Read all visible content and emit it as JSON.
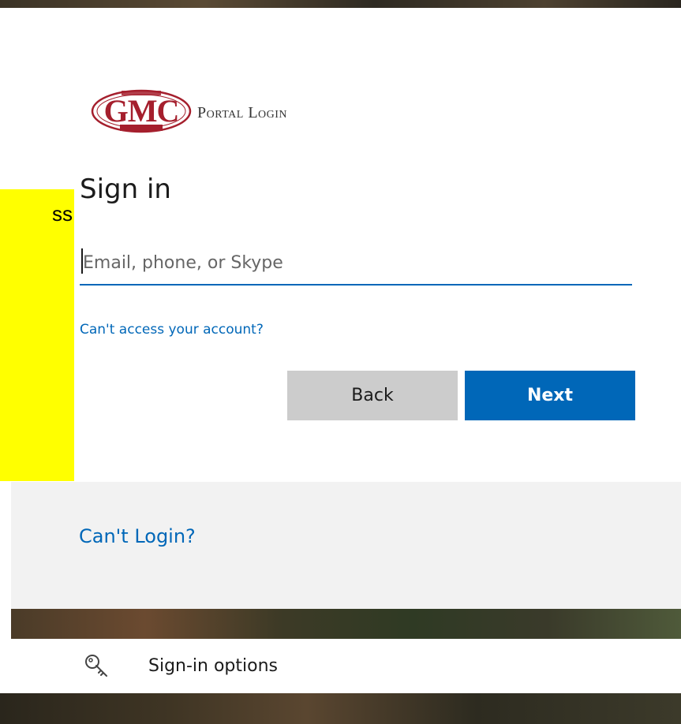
{
  "logo": {
    "text": "GMC",
    "subtitle": "Portal Login",
    "color": "#a51f2d"
  },
  "signin": {
    "title": "Sign in",
    "email_placeholder": "Email, phone, or Skype",
    "email_value": "",
    "help_link": "Can't access your account?",
    "back_label": "Back",
    "next_label": "Next"
  },
  "callout": {
    "visible_text": "ss"
  },
  "footer": {
    "cant_login": "Can't Login?"
  },
  "options": {
    "label": "Sign-in options",
    "icon": "key-icon"
  },
  "colors": {
    "accent": "#0067b8",
    "back_button": "#cccccc",
    "highlight": "#ffff00",
    "footer_band": "#f2f2f2"
  }
}
